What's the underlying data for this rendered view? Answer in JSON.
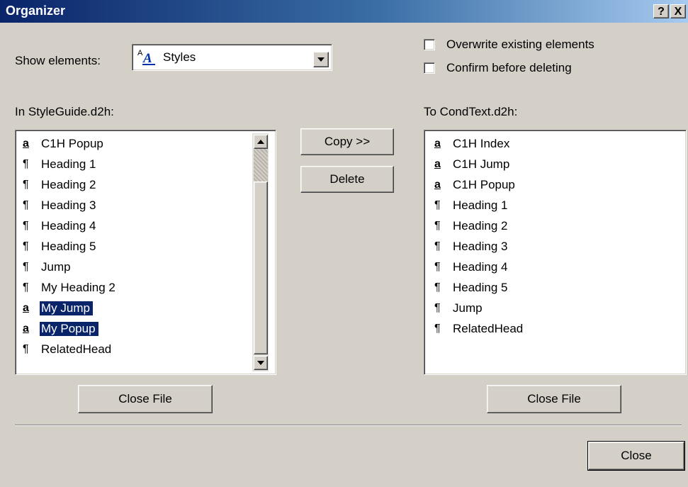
{
  "window": {
    "title": "Organizer",
    "help_label": "?",
    "close_label": "X"
  },
  "show_elements": {
    "label": "Show elements:",
    "selected_icon": "styles-icon",
    "selected": "Styles"
  },
  "options": {
    "overwrite_label": "Overwrite existing elements",
    "overwrite_checked": false,
    "confirm_label": "Confirm before deleting",
    "confirm_checked": false
  },
  "left_pane": {
    "label": "In StyleGuide.d2h:",
    "items": [
      {
        "icon": "character-style-icon",
        "glyph": "a",
        "label": "C1H Popup",
        "selected": false
      },
      {
        "icon": "paragraph-style-icon",
        "glyph": "¶",
        "label": "Heading 1",
        "selected": false
      },
      {
        "icon": "paragraph-style-icon",
        "glyph": "¶",
        "label": "Heading 2",
        "selected": false
      },
      {
        "icon": "paragraph-style-icon",
        "glyph": "¶",
        "label": "Heading 3",
        "selected": false
      },
      {
        "icon": "paragraph-style-icon",
        "glyph": "¶",
        "label": "Heading 4",
        "selected": false
      },
      {
        "icon": "paragraph-style-icon",
        "glyph": "¶",
        "label": "Heading 5",
        "selected": false
      },
      {
        "icon": "paragraph-style-icon",
        "glyph": "¶",
        "label": "Jump",
        "selected": false
      },
      {
        "icon": "paragraph-style-icon",
        "glyph": "¶",
        "label": "My Heading 2",
        "selected": false
      },
      {
        "icon": "character-style-icon",
        "glyph": "a",
        "label": "My Jump",
        "selected": true
      },
      {
        "icon": "character-style-icon",
        "glyph": "a",
        "label": "My Popup",
        "selected": true
      },
      {
        "icon": "paragraph-style-icon",
        "glyph": "¶",
        "label": "RelatedHead",
        "selected": false
      }
    ],
    "close_file_label": "Close File"
  },
  "middle": {
    "copy_label": "Copy >>",
    "delete_label": "Delete"
  },
  "right_pane": {
    "label": "To CondText.d2h:",
    "items": [
      {
        "icon": "character-style-icon",
        "glyph": "a",
        "label": "C1H Index"
      },
      {
        "icon": "character-style-icon",
        "glyph": "a",
        "label": "C1H Jump"
      },
      {
        "icon": "character-style-icon",
        "glyph": "a",
        "label": "C1H Popup"
      },
      {
        "icon": "paragraph-style-icon",
        "glyph": "¶",
        "label": "Heading 1"
      },
      {
        "icon": "paragraph-style-icon",
        "glyph": "¶",
        "label": "Heading 2"
      },
      {
        "icon": "paragraph-style-icon",
        "glyph": "¶",
        "label": "Heading 3"
      },
      {
        "icon": "paragraph-style-icon",
        "glyph": "¶",
        "label": "Heading 4"
      },
      {
        "icon": "paragraph-style-icon",
        "glyph": "¶",
        "label": "Heading 5"
      },
      {
        "icon": "paragraph-style-icon",
        "glyph": "¶",
        "label": "Jump"
      },
      {
        "icon": "paragraph-style-icon",
        "glyph": "¶",
        "label": "RelatedHead"
      }
    ],
    "close_file_label": "Close File"
  },
  "footer": {
    "close_label": "Close"
  },
  "colors": {
    "selection": "#0a246a",
    "titlebar_start": "#0a246a",
    "titlebar_end": "#a6caf0",
    "dialog_bg": "#d4d0c8"
  }
}
